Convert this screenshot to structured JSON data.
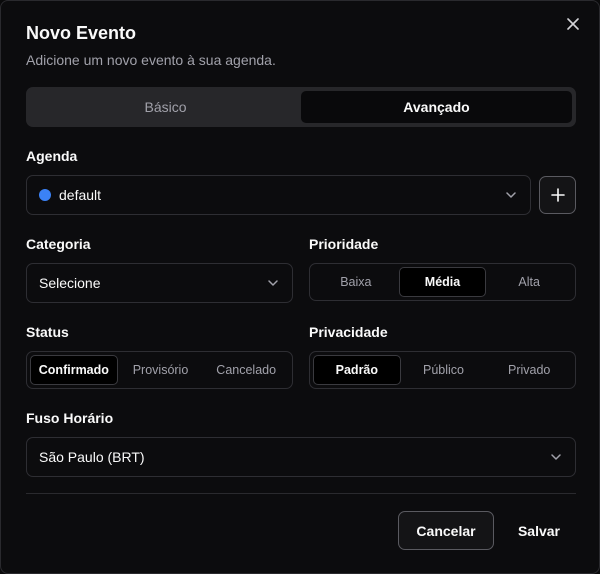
{
  "dialog": {
    "title": "Novo Evento",
    "subtitle": "Adicione um novo evento à sua agenda."
  },
  "tabs": [
    {
      "label": "Básico",
      "active": false
    },
    {
      "label": "Avançado",
      "active": true
    }
  ],
  "agenda": {
    "label": "Agenda",
    "value": "default",
    "color": "#3b82f6"
  },
  "categoria": {
    "label": "Categoria",
    "value": "Selecione"
  },
  "prioridade": {
    "label": "Prioridade",
    "options": [
      "Baixa",
      "Média",
      "Alta"
    ],
    "selected": "Média"
  },
  "status": {
    "label": "Status",
    "options": [
      "Confirmado",
      "Provisório",
      "Cancelado"
    ],
    "selected": "Confirmado"
  },
  "privacidade": {
    "label": "Privacidade",
    "options": [
      "Padrão",
      "Público",
      "Privado"
    ],
    "selected": "Padrão"
  },
  "fuso": {
    "label": "Fuso Horário",
    "value": "São Paulo (BRT)"
  },
  "footer": {
    "cancel_label": "Cancelar",
    "save_label": "Salvar"
  },
  "icons": {
    "close": "close-icon",
    "chevron": "chevron-down-icon",
    "add": "plus-icon"
  }
}
